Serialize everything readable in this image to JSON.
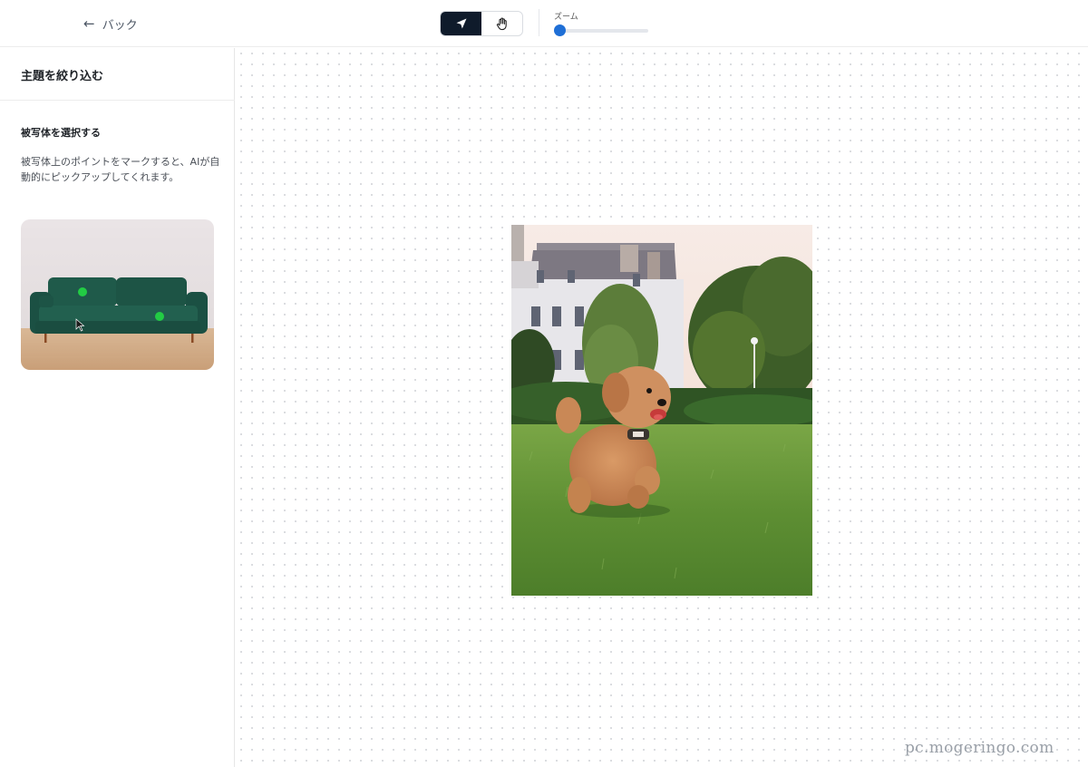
{
  "topbar": {
    "back_label": "バック",
    "zoom_label": "ズーム",
    "zoom_level": 0,
    "tools": [
      {
        "name": "select",
        "active": true
      },
      {
        "name": "pan",
        "active": false
      }
    ]
  },
  "sidebar": {
    "title": "主題を絞り込む",
    "subtitle": "被写体を選択する",
    "description": "被写体上のポイントをマークすると、AIが自動的にピックアップしてくれます。",
    "example_image": "sofa-with-marked-points"
  },
  "canvas": {
    "image": "dog-running-on-grass"
  },
  "watermark": "pc.mogeringo.com",
  "colors": {
    "accent": "#1f6fd6",
    "tool_active": "#0f1b2b",
    "marker": "#22cc44"
  }
}
